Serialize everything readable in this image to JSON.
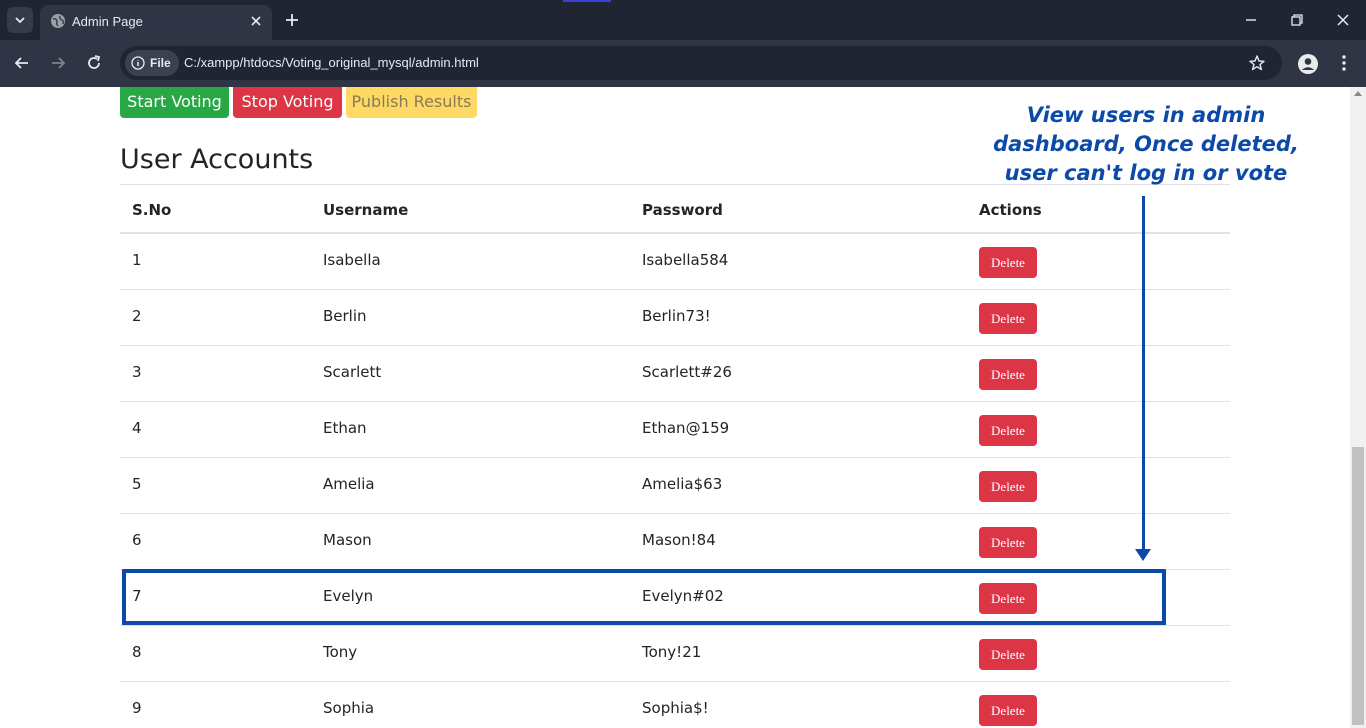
{
  "browser": {
    "tab_title": "Admin Page",
    "file_chip": "File",
    "url": "C:/xampp/htdocs/Voting_original_mysql/admin.html"
  },
  "controls": {
    "start_label": "Start Voting",
    "stop_label": "Stop Voting",
    "publish_label": "Publish Results"
  },
  "page": {
    "heading": "User Accounts"
  },
  "table": {
    "headers": [
      "S.No",
      "Username",
      "Password",
      "Actions"
    ],
    "rows": [
      {
        "sno": "1",
        "username": "Isabella",
        "password": "Isabella584",
        "action": "Delete"
      },
      {
        "sno": "2",
        "username": "Berlin",
        "password": "Berlin73!",
        "action": "Delete"
      },
      {
        "sno": "3",
        "username": "Scarlett",
        "password": "Scarlett#26",
        "action": "Delete"
      },
      {
        "sno": "4",
        "username": "Ethan",
        "password": "Ethan@159",
        "action": "Delete"
      },
      {
        "sno": "5",
        "username": "Amelia",
        "password": "Amelia$63",
        "action": "Delete"
      },
      {
        "sno": "6",
        "username": "Mason",
        "password": "Mason!84",
        "action": "Delete"
      },
      {
        "sno": "7",
        "username": "Evelyn",
        "password": "Evelyn#02",
        "action": "Delete"
      },
      {
        "sno": "8",
        "username": "Tony",
        "password": "Tony!21",
        "action": "Delete"
      },
      {
        "sno": "9",
        "username": "Sophia",
        "password": "Sophia$!",
        "action": "Delete"
      }
    ]
  },
  "annotation": {
    "text": "View users in admin dashboard, Once deleted, user can't log in or vote"
  },
  "colors": {
    "accent": "#0b4aa8",
    "success": "#28a745",
    "danger": "#dc3545",
    "warning": "#ffd966"
  }
}
